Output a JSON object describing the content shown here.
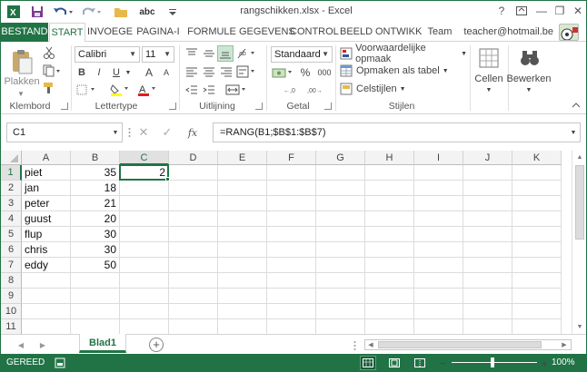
{
  "window": {
    "title": "rangschikken.xlsx - Excel",
    "help": "?",
    "minimize": "—",
    "restore": "❐",
    "close": "✕"
  },
  "qat": {
    "spelling": "abc"
  },
  "tabs": [
    "BESTAND",
    "START",
    "INVOEGE",
    "PAGINA-I",
    "FORMULE",
    "GEGEVENS",
    "CONTROL",
    "BEELD",
    "ONTWIKK",
    "Team"
  ],
  "user": "teacher@hotmail.be",
  "ribbon": {
    "clipboard": {
      "paste": "Plakken",
      "label": "Klembord"
    },
    "font": {
      "name": "Calibri",
      "size": "11",
      "bold": "B",
      "italic": "I",
      "underline": "U",
      "grow": "A",
      "shrink": "A",
      "label": "Lettertype"
    },
    "alignment": {
      "label": "Uitlijning"
    },
    "number": {
      "format": "Standaard",
      "percent": "%",
      "thousands": "000",
      "label": "Getal"
    },
    "styles": {
      "conditional": "Voorwaardelijke opmaak",
      "table": "Opmaken als tabel",
      "cell": "Celstijlen",
      "label": "Stijlen"
    },
    "cells": {
      "label": "Cellen"
    },
    "editing": {
      "label": "Bewerken"
    }
  },
  "formula_bar": {
    "name_box": "C1",
    "fx": "fx",
    "formula": "=RANG(B1;$B$1:$B$7)"
  },
  "grid": {
    "columns": [
      "A",
      "B",
      "C",
      "D",
      "E",
      "F",
      "G",
      "H",
      "I",
      "J",
      "K"
    ],
    "rows": [
      "1",
      "2",
      "3",
      "4",
      "5",
      "6",
      "7",
      "8",
      "9",
      "10",
      "11"
    ],
    "col_a": [
      "piet",
      "jan",
      "peter",
      "guust",
      "flup",
      "chris",
      "eddy"
    ],
    "col_b": [
      "35",
      "18",
      "21",
      "20",
      "30",
      "30",
      "50"
    ],
    "col_c": [
      "2"
    ]
  },
  "sheets": {
    "active": "Blad1",
    "add": "+"
  },
  "status": {
    "mode": "GEREED",
    "zoom": "100%",
    "minus": "−",
    "plus": "+"
  },
  "colors": {
    "accent": "#217346"
  }
}
